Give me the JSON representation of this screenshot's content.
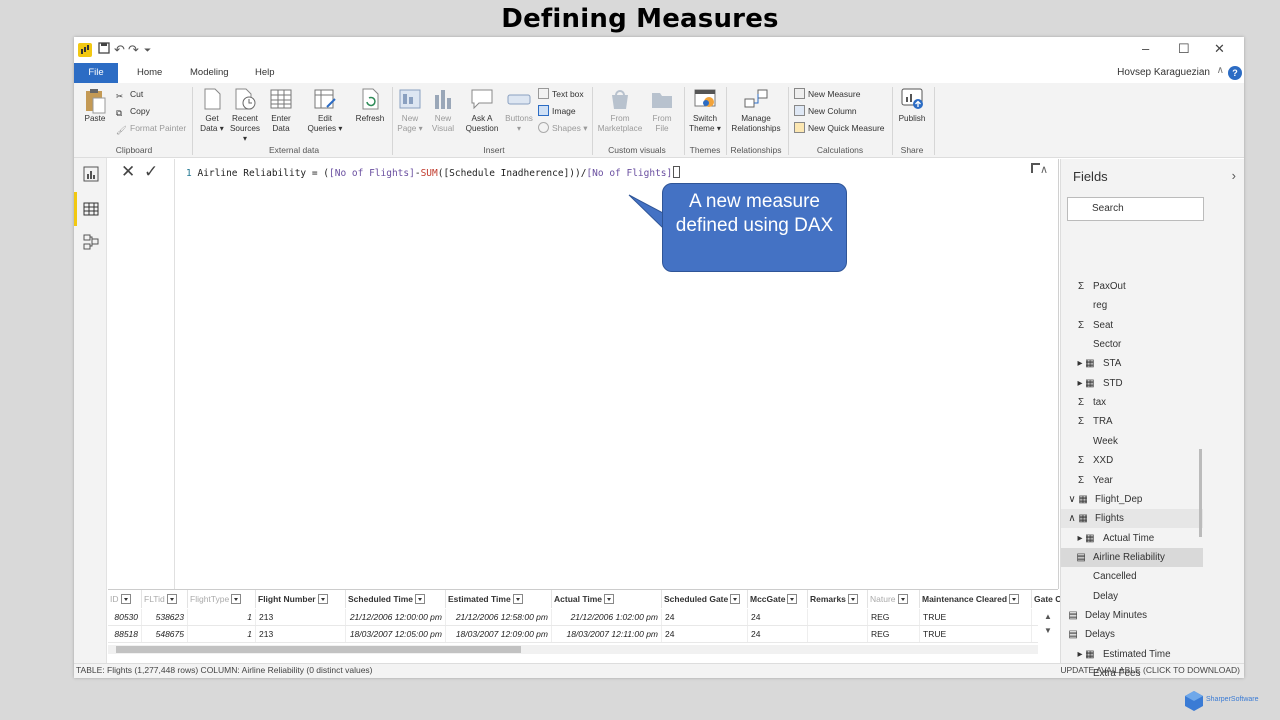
{
  "slide": {
    "title": "Defining Measures",
    "brand": "SharperSoftware"
  },
  "titlebar": {
    "undo": "↶",
    "redo": "↷",
    "qat_more": "⏷",
    "minimize": "–",
    "maximize": "☐",
    "close": "✕"
  },
  "tabs": {
    "file": "File",
    "home": "Home",
    "modeling": "Modeling",
    "help": "Help",
    "user": "Hovsep Karaguezian"
  },
  "ribbon": {
    "paste": "Paste",
    "cut": "Cut",
    "copy": "Copy",
    "format_painter": "Format Painter",
    "clipboard": "Clipboard",
    "get_data": "Get Data ▾",
    "recent_sources": "Recent Sources ▾",
    "enter_data": "Enter Data",
    "edit_queries": "Edit Queries ▾",
    "refresh": "Refresh",
    "external_data": "External data",
    "new_page": "New Page ▾",
    "new_visual": "New Visual",
    "ask_question": "Ask A Question",
    "buttons": "Buttons ▾",
    "text_box": "Text box",
    "image": "Image",
    "shapes": "Shapes ▾",
    "insert": "Insert",
    "from_marketplace": "From Marketplace",
    "from_file": "From File",
    "custom_visuals": "Custom visuals",
    "switch_theme": "Switch Theme ▾",
    "themes": "Themes",
    "manage_relationships": "Manage Relationships",
    "relationships": "Relationships",
    "new_measure": "New Measure",
    "new_column": "New Column",
    "new_quick_measure": "New Quick Measure",
    "calculations": "Calculations",
    "publish": "Publish",
    "share": "Share"
  },
  "formula": {
    "line": "1",
    "p1": "Airline Reliability = (",
    "ref1": "[No of Flights]",
    "p2": "-",
    "fn": "SUM",
    "p3": "([Schedule Inadherence]))/",
    "ref2": "[No of Flights]"
  },
  "callout": {
    "text": "A new measure defined using DAX"
  },
  "grid": {
    "headers": [
      "ID",
      "FLTid",
      "FlightType",
      "Flight Number",
      "Scheduled Time",
      "Estimated Time",
      "Actual Time",
      "Scheduled Gate",
      "MccGate",
      "Remarks",
      "Nature",
      "Maintenance Cleared",
      "Gate Char"
    ],
    "rows": [
      [
        "80530",
        "538623",
        "1",
        "213",
        "21/12/2006 12:00:00 pm",
        "21/12/2006 12:58:00 pm",
        "21/12/2006 1:02:00 pm",
        "24",
        "24",
        "",
        "REG",
        "TRUE",
        ""
      ],
      [
        "88518",
        "548675",
        "1",
        "213",
        "18/03/2007 12:05:00 pm",
        "18/03/2007 12:09:00 pm",
        "18/03/2007 12:11:00 pm",
        "24",
        "24",
        "",
        "REG",
        "TRUE",
        ""
      ]
    ]
  },
  "status": {
    "left": "TABLE: Flights (1,277,448 rows) COLUMN: Airline Reliability (0 distinct values)",
    "right": "UPDATE AVAILABLE (CLICK TO DOWNLOAD)"
  },
  "fields": {
    "title": "Fields",
    "search_placeholder": "Search",
    "items": [
      {
        "sym": "Σ",
        "label": "PaxOut",
        "indent": 1
      },
      {
        "sym": "",
        "label": "reg",
        "indent": 1
      },
      {
        "sym": "Σ",
        "label": "Seat",
        "indent": 1
      },
      {
        "sym": "",
        "label": "Sector",
        "indent": 1
      },
      {
        "sym": "▸ ▦",
        "label": "STA",
        "indent": 1
      },
      {
        "sym": "▸ ▦",
        "label": "STD",
        "indent": 1
      },
      {
        "sym": "Σ",
        "label": "tax",
        "indent": 1
      },
      {
        "sym": "Σ",
        "label": "TRA",
        "indent": 1
      },
      {
        "sym": "",
        "label": "Week",
        "indent": 1
      },
      {
        "sym": "Σ",
        "label": "XXD",
        "indent": 1
      },
      {
        "sym": "Σ",
        "label": "Year",
        "indent": 1
      },
      {
        "sym": "∨ ▦",
        "label": "Flight_Dep",
        "indent": 0
      },
      {
        "sym": "∧ ▦",
        "label": "Flights",
        "indent": 0
      },
      {
        "sym": "▸ ▦",
        "label": "Actual Time",
        "indent": 1
      },
      {
        "sym": "▤",
        "label": "Airline Reliability",
        "indent": 1
      },
      {
        "sym": "",
        "label": "Cancelled",
        "indent": 1
      },
      {
        "sym": "",
        "label": "Delay",
        "indent": 1
      },
      {
        "sym": "▤",
        "label": "Delay Minutes",
        "indent": 0
      },
      {
        "sym": "▤",
        "label": "Delays",
        "indent": 0
      },
      {
        "sym": "▸ ▦",
        "label": "Estimated Time",
        "indent": 1
      },
      {
        "sym": "",
        "label": "Extra Fees",
        "indent": 1
      }
    ]
  },
  "colors": {
    "accent": "#2c6cc4",
    "callout": "#4472c4",
    "pbi_yellow": "#f2c811"
  }
}
